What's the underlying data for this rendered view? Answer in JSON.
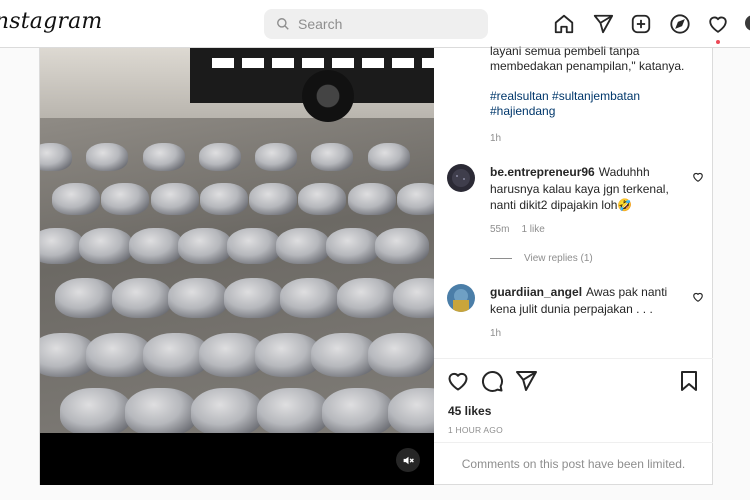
{
  "header": {
    "logo": "Instagram",
    "search": {
      "placeholder": "Search",
      "value": ""
    },
    "nav_icons": [
      "home-icon",
      "direct-icon",
      "new-post-icon",
      "explore-icon",
      "activity-icon",
      "profile-avatar"
    ]
  },
  "post": {
    "caption_partial": "layani semua pembeli tanpa membedakan penampilan,\" katanya.",
    "hashtags": "#realsultan #sultanjembatan #hajiendang",
    "caption_time": "1h",
    "comments": [
      {
        "username": "be.entrepreneur96",
        "text": "Waduhhh harusnya kalau kaya jgn terkenal, nanti dikit2 dipajakin loh🤣",
        "time": "55m",
        "likes": "1 like"
      },
      {
        "username": "guardiian_angel",
        "text": "Awas pak nanti kena julit dunia perpajakan . . .",
        "time": "1h"
      }
    ],
    "view_replies": "View replies (1)",
    "likes": "45 likes",
    "time_ago": "1 HOUR AGO",
    "comments_limited": "Comments on this post have been limited."
  },
  "colors": {
    "accent_link": "#00376b",
    "notification_dot": "#ed4956",
    "muted_text": "#8e8e8e"
  }
}
